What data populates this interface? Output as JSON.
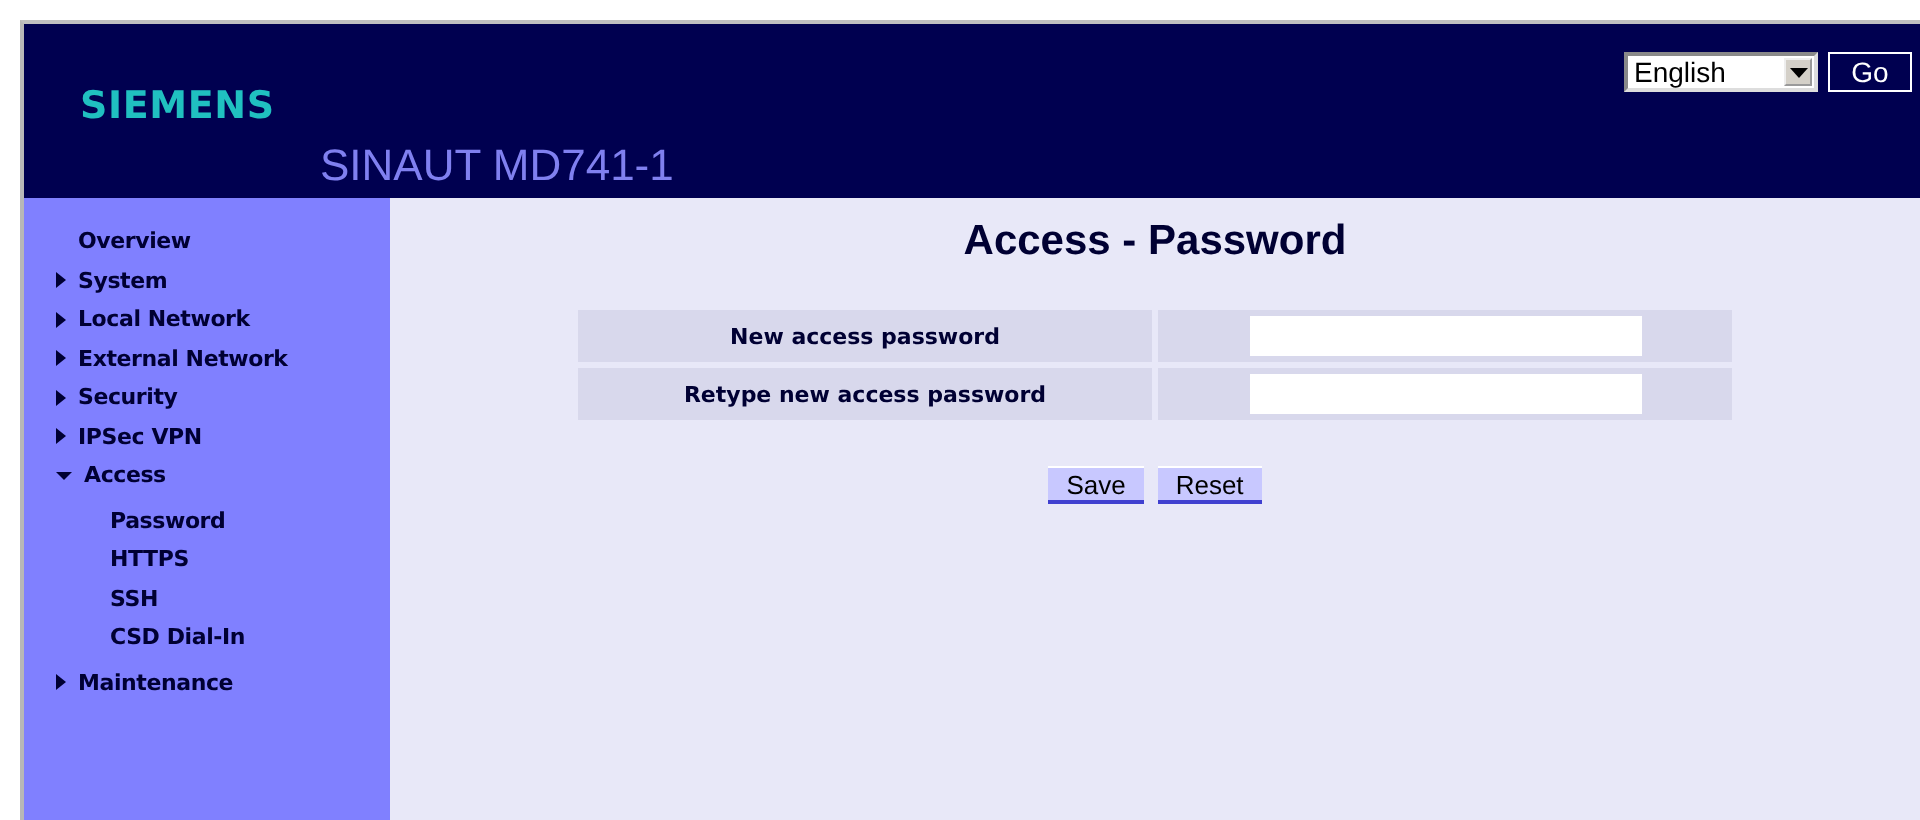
{
  "header": {
    "logo": "SIEMENS",
    "product": "SINAUT MD741-1",
    "language": {
      "value": "English"
    },
    "go_button": "Go"
  },
  "sidebar": {
    "items": [
      {
        "label": "Overview",
        "kind": "leaf"
      },
      {
        "label": "System",
        "kind": "branch",
        "expanded": false
      },
      {
        "label": "Local Network",
        "kind": "branch",
        "expanded": false
      },
      {
        "label": "External Network",
        "kind": "branch",
        "expanded": false
      },
      {
        "label": "Security",
        "kind": "branch",
        "expanded": false
      },
      {
        "label": "IPSec VPN",
        "kind": "branch",
        "expanded": false
      },
      {
        "label": "Access",
        "kind": "branch",
        "expanded": true,
        "children": [
          {
            "label": "Password"
          },
          {
            "label": "HTTPS"
          },
          {
            "label": "SSH"
          },
          {
            "label": "CSD Dial-In"
          }
        ]
      },
      {
        "label": "Maintenance",
        "kind": "branch",
        "expanded": false
      }
    ]
  },
  "page": {
    "title": "Access - Password",
    "fields": [
      {
        "label": "New access password"
      },
      {
        "label": "Retype new access password"
      }
    ],
    "buttons": [
      "Save",
      "Reset"
    ]
  }
}
